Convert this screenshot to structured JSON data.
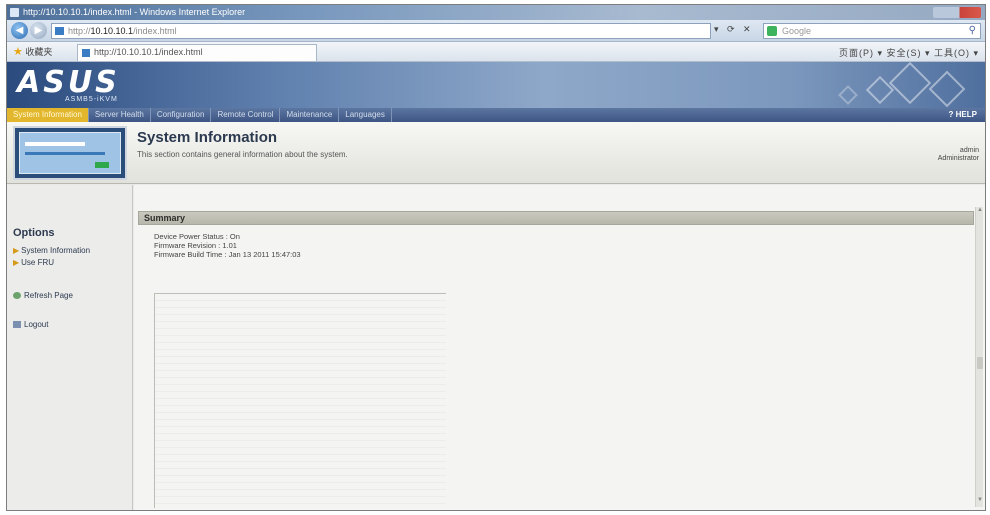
{
  "window": {
    "title": "http://10.10.10.1/index.html - Windows Internet Explorer"
  },
  "navbar": {
    "back_icon": "back-arrow-icon",
    "forward_icon": "forward-arrow-icon",
    "address_prefix": "http://",
    "address_host": "10.10.10.1",
    "address_path": "/index.html",
    "search_placeholder": "Google"
  },
  "cmdbar": {
    "favorites_label": "收藏夹",
    "tab_title": "http://10.10.10.1/index.html",
    "tools": "页面(P) ▾  安全(S) ▾  工具(O) ▾"
  },
  "banner": {
    "logo": "ASUS",
    "logo_sub": "ASMB5-iKVM"
  },
  "mainnav": {
    "items": [
      {
        "label": "System Information"
      },
      {
        "label": "Server Health"
      },
      {
        "label": "Configuration"
      },
      {
        "label": "Remote Control"
      },
      {
        "label": "Maintenance"
      },
      {
        "label": "Languages"
      }
    ],
    "help_label": "? HELP"
  },
  "header": {
    "title": "System Information",
    "description": "This section contains general information about the system.",
    "user": "admin",
    "role": "Administrator"
  },
  "sidebar": {
    "title": "Options",
    "items": [
      {
        "label": "System Information"
      },
      {
        "label": "Use FRU"
      },
      {
        "label": "Refresh Page"
      },
      {
        "label": "Logout"
      }
    ]
  },
  "summary": {
    "title": "Summary",
    "lines": [
      "Device Power Status : On",
      "Firmware Revision : 1.01",
      "Firmware Build Time : Jan 13 2011 15:47:03"
    ]
  },
  "colors": {
    "nav_active": "#e2b72d",
    "nav_background": "#3d5584",
    "banner": "#5b7cab"
  }
}
